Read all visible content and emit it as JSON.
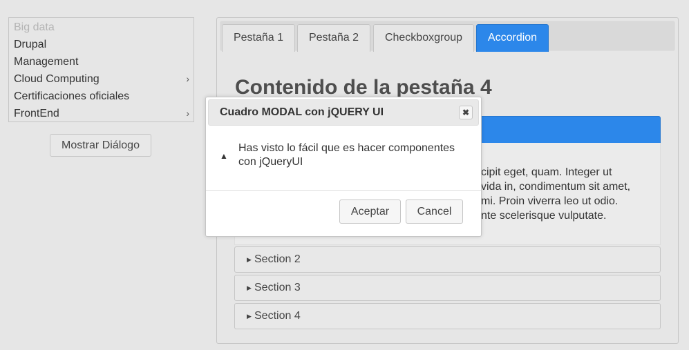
{
  "menu": {
    "items": [
      {
        "label": "Big data",
        "disabled": true,
        "submenu": false
      },
      {
        "label": "Drupal",
        "disabled": false,
        "submenu": false
      },
      {
        "label": "Management",
        "disabled": false,
        "submenu": false
      },
      {
        "label": "Cloud Computing",
        "disabled": false,
        "submenu": true
      },
      {
        "label": "Certificaciones oficiales",
        "disabled": false,
        "submenu": false
      },
      {
        "label": "FrontEnd",
        "disabled": false,
        "submenu": true
      }
    ],
    "submenu_arrow": "›"
  },
  "show_dialog_label": "Mostrar Diálogo",
  "tabs": {
    "items": [
      "Pestaña 1",
      "Pestaña 2",
      "Checkboxgroup",
      "Accordion"
    ],
    "active_index": 3
  },
  "content": {
    "title": "Contenido de la pestaña 4",
    "panel_lines": [
      "cipit eget, quam. Integer ut",
      "vida in, condimentum sit amet,",
      "mi. Proin viverra leo ut odio.",
      "nte scelerisque vulputate."
    ],
    "sections": [
      "Section 2",
      "Section 3",
      "Section 4"
    ],
    "section_icon": "triangle-right-icon"
  },
  "dialog": {
    "title": "Cuadro MODAL con jQUERY UI",
    "close_symbol": "✖",
    "icon": "warning-icon",
    "message": "Has visto lo fácil que es hacer componentes con jQueryUI",
    "ok_label": "Aceptar",
    "cancel_label": "Cancel"
  },
  "colors": {
    "accent": "#2c87ea",
    "background": "#e6e6e6"
  }
}
